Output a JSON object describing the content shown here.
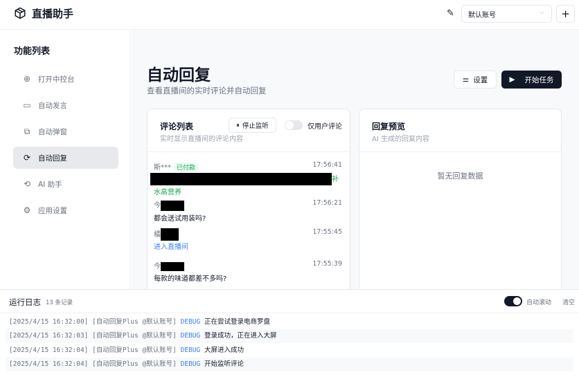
{
  "header": {
    "title": "直播助手",
    "account": "默认账号"
  },
  "sidebar": {
    "title": "功能列表",
    "items": [
      {
        "label": "打开中控台",
        "icon": "globe-icon"
      },
      {
        "label": "自动发言",
        "icon": "message-icon"
      },
      {
        "label": "自动弹窗",
        "icon": "popup-icon"
      },
      {
        "label": "自动回复",
        "icon": "reply-icon"
      },
      {
        "label": "AI 助手",
        "icon": "ai-icon"
      },
      {
        "label": "应用设置",
        "icon": "gear-icon"
      }
    ]
  },
  "main": {
    "title": "自动回复",
    "subtitle": "查看直播间的实时评论并自动回复",
    "settings_label": "设置",
    "start_label": "开始任务",
    "comments": {
      "title": "评论列表",
      "subtitle": "实时显示直播间的评论内容",
      "stop_label": "停止监听",
      "toggle_label": "仅用户评论",
      "items": [
        {
          "user": "斯***",
          "badge": "已付款",
          "time": "17:56:41",
          "tail": "补",
          "text": "水高营养"
        },
        {
          "user": "今",
          "time": "17:56:21",
          "text": "都会送试用装吗?"
        },
        {
          "user": "橘",
          "time": "17:55:45",
          "text": "进入直播间"
        },
        {
          "user": "今",
          "time": "17:55:39",
          "text": "每款的味道都差不多吗?"
        }
      ]
    },
    "preview": {
      "title": "回复预览",
      "subtitle": "AI 生成的回复内容",
      "empty": "暂无回复数据"
    }
  },
  "log": {
    "title": "运行日志",
    "count": "13 条记录",
    "autoscroll": "自动滚动",
    "clear": "清空",
    "rows": [
      {
        "ts": "[2025/4/15 16:32:00]",
        "src": "[自动回复Plus @默认账号]",
        "level": "DEBUG",
        "msg": "正在尝试登录电商罗盘"
      },
      {
        "ts": "[2025/4/15 16:32:03]",
        "src": "[自动回复Plus @默认账号]",
        "level": "DEBUG",
        "msg": "登录成功，正在进入大屏"
      },
      {
        "ts": "[2025/4/15 16:32:04]",
        "src": "[自动回复Plus @默认账号]",
        "level": "DEBUG",
        "msg": "大屏进入成功"
      },
      {
        "ts": "[2025/4/15 16:32:04]",
        "src": "[自动回复Plus @默认账号]",
        "level": "DEBUG",
        "msg": "开始监听评论"
      }
    ]
  }
}
